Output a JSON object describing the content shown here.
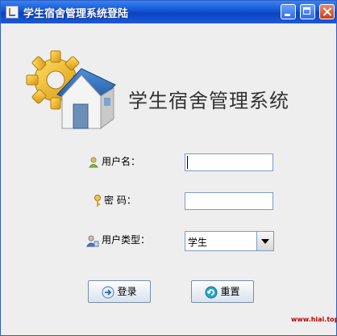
{
  "window": {
    "title": "学生宿舍管理系统登陆",
    "system_title": "学生宿舍管理系统",
    "accent_color": "#1153d4"
  },
  "form": {
    "username_label": "用户名：",
    "username_value": "",
    "password_label": "密  码：",
    "password_value": "",
    "usertype_label": "用户类型：",
    "usertype_selected": "学生"
  },
  "buttons": {
    "login_label": "登录",
    "reset_label": "重置"
  },
  "icons": {
    "logo": "gear-house-icon",
    "user": "person-icon",
    "password": "key-icon",
    "usertype": "user-group-icon",
    "login": "arrow-right-icon",
    "reset": "refresh-icon"
  },
  "watermark": "www.hiai.top"
}
